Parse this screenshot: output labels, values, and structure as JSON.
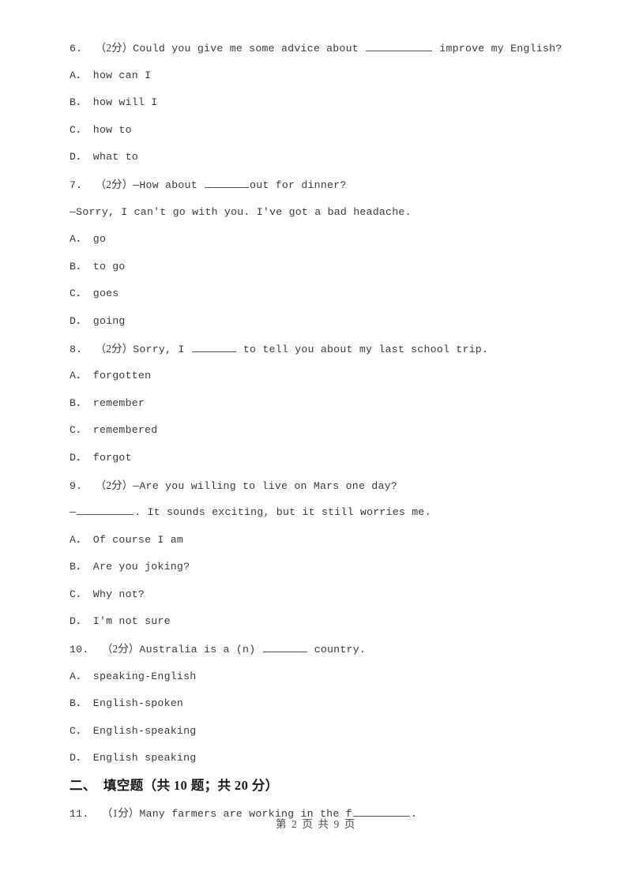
{
  "document": {
    "type": "exam-paper",
    "page_background": "#ffffff",
    "text_color": "#3a3a3a"
  },
  "questions": [
    {
      "number": "6.",
      "score": "（2分）",
      "stem_before": "Could you give me some advice about ",
      "blank": "w-xl",
      "stem_after": " improve my English?",
      "options": [
        {
          "letter": "A．",
          "text": "how can I"
        },
        {
          "letter": "B．",
          "text": "how will I"
        },
        {
          "letter": "C．",
          "text": "how to"
        },
        {
          "letter": "D．",
          "text": "what to"
        }
      ]
    },
    {
      "number": "7.",
      "score": "（2分）",
      "stem_before": "—How about ",
      "blank": "w-md",
      "stem_after": "out for dinner?",
      "extra_line": "—Sorry, I can't go with you. I've got a bad headache.",
      "options": [
        {
          "letter": "A．",
          "text": "go"
        },
        {
          "letter": "B．",
          "text": "to go"
        },
        {
          "letter": "C．",
          "text": "goes"
        },
        {
          "letter": "D．",
          "text": "going"
        }
      ]
    },
    {
      "number": "8.",
      "score": "（2分）",
      "stem_before": "Sorry, I ",
      "blank": "w-md",
      "stem_after": " to tell you about my last school trip.",
      "options": [
        {
          "letter": "A．",
          "text": "forgotten"
        },
        {
          "letter": "B．",
          "text": "remember"
        },
        {
          "letter": "C．",
          "text": "remembered"
        },
        {
          "letter": "D．",
          "text": "forgot"
        }
      ]
    },
    {
      "number": "9.",
      "score": "（2分）",
      "stem_before": "—Are you willing to live on Mars one day?",
      "blank": "",
      "stem_after": "",
      "answer_prefix": "—",
      "answer_blank": "w-lg",
      "answer_suffix": ". It sounds exciting, but it still worries me.",
      "options": [
        {
          "letter": "A．",
          "text": "Of course I am"
        },
        {
          "letter": "B．",
          "text": "Are you joking?"
        },
        {
          "letter": "C．",
          "text": "Why not?"
        },
        {
          "letter": "D．",
          "text": "I'm not sure"
        }
      ]
    },
    {
      "number": "10.",
      "score": "（2分）",
      "stem_before": "Australia is a (n) ",
      "blank": "w-md",
      "stem_after": " country.",
      "options": [
        {
          "letter": "A．",
          "text": "speaking-English"
        },
        {
          "letter": "B．",
          "text": "English-spoken"
        },
        {
          "letter": "C．",
          "text": "English-speaking"
        },
        {
          "letter": "D．",
          "text": "English speaking"
        }
      ]
    }
  ],
  "section_heading": "二、  填空题（共 10 题；共 20 分）",
  "question11": {
    "number": "11.",
    "score": "（1分）",
    "stem_before": "Many farmers are working in the f",
    "blank": "w-lg",
    "stem_after": "."
  },
  "footer": {
    "text": "第 2 页 共 9 页"
  }
}
